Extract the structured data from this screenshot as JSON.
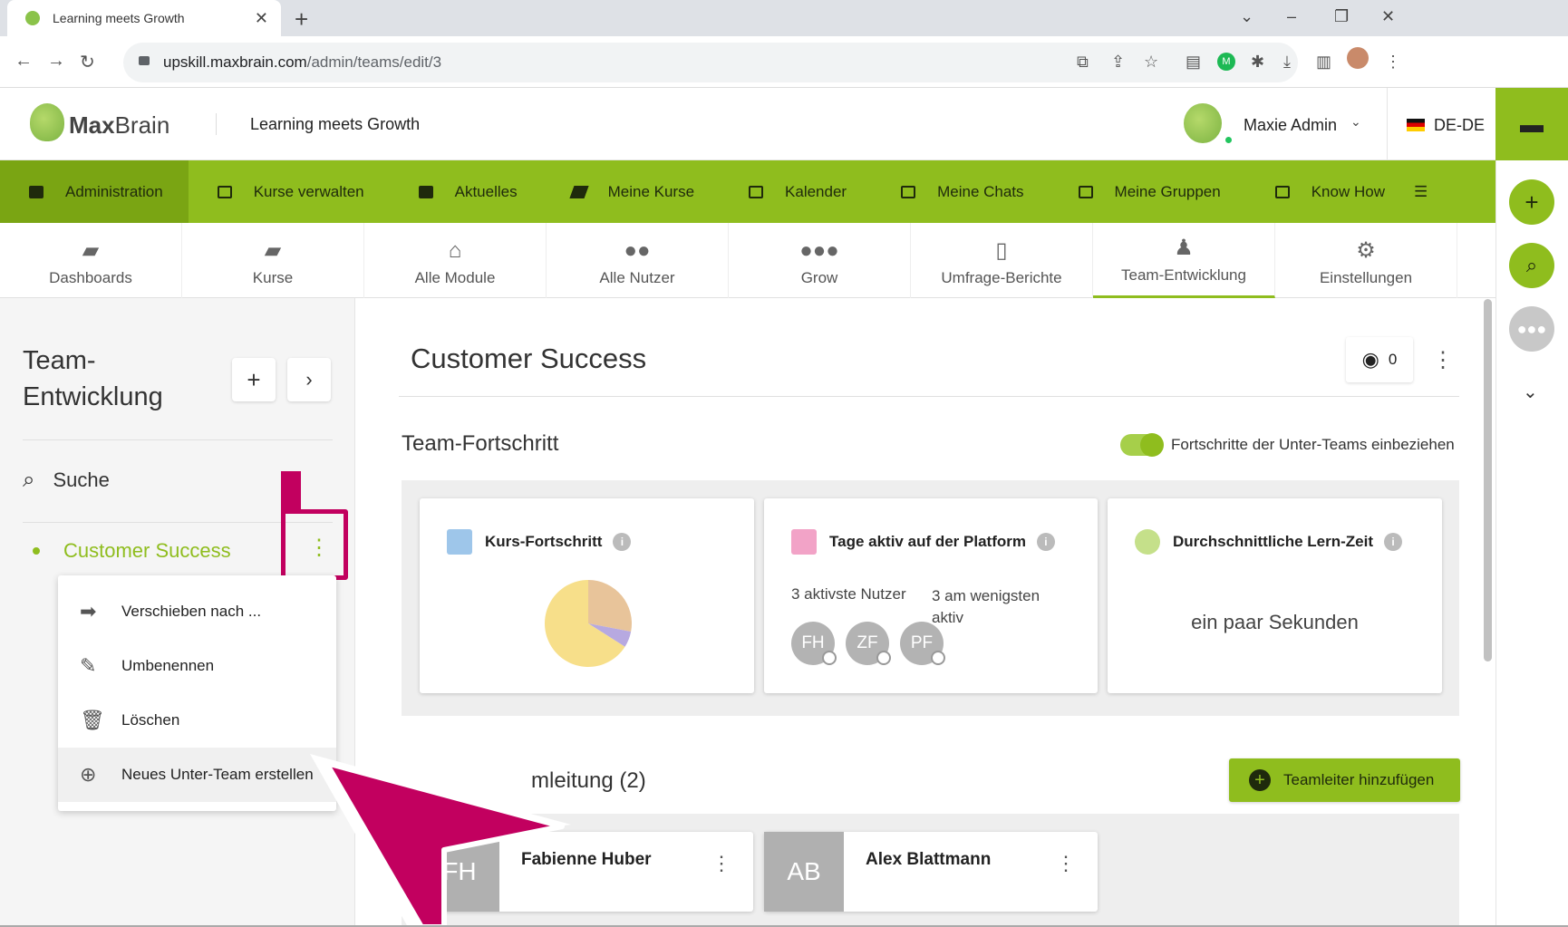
{
  "browser": {
    "tab_title": "Learning meets Growth",
    "url_host": "upskill.maxbrain.com",
    "url_path": "/admin/teams/edit/3"
  },
  "header": {
    "logo_bold": "Max",
    "logo_light": "Brain",
    "tagline": "Learning meets Growth",
    "user_name": "Maxie Admin",
    "language": "DE-DE"
  },
  "main_nav": [
    {
      "label": "Administration"
    },
    {
      "label": "Kurse verwalten"
    },
    {
      "label": "Aktuelles"
    },
    {
      "label": "Meine Kurse"
    },
    {
      "label": "Kalender"
    },
    {
      "label": "Meine Chats"
    },
    {
      "label": "Meine Gruppen"
    },
    {
      "label": "Know How"
    }
  ],
  "sub_nav": [
    {
      "label": "Dashboards"
    },
    {
      "label": "Kurse"
    },
    {
      "label": "Alle Module"
    },
    {
      "label": "Alle Nutzer"
    },
    {
      "label": "Grow"
    },
    {
      "label": "Umfrage-Berichte"
    },
    {
      "label": "Team-Entwicklung"
    },
    {
      "label": "Einstellungen"
    }
  ],
  "sidebar": {
    "title_line1": "Team-",
    "title_line2": "Entwicklung",
    "search_label": "Suche",
    "team_name": "Customer Success",
    "context_menu": [
      {
        "label": "Verschieben nach ..."
      },
      {
        "label": "Umbenennen"
      },
      {
        "label": "Löschen"
      },
      {
        "label": "Neues Unter-Team erstellen"
      }
    ]
  },
  "content": {
    "title": "Customer Success",
    "view_count": "0",
    "progress_section": "Team-Fortschritt",
    "toggle_label": "Fortschritte der Unter-Teams einbeziehen",
    "toggle_on": true,
    "cards": {
      "course_progress": "Kurs-Fortschritt",
      "days_active": "Tage aktiv auf der Platform",
      "most_active": "3 aktivste Nutzer",
      "least_active_1": "3 am wenigsten",
      "least_active_2": "aktiv",
      "avg_time": "Durchschnittliche Lern-Zeit",
      "avg_time_value": "ein paar Sekunden"
    },
    "active_users": [
      "FH",
      "ZF",
      "PF"
    ],
    "leaders_section_visible": "mleitung (2)",
    "add_leader_label": "Teamleiter hinzufügen",
    "leaders": [
      {
        "initials": "FH",
        "name": "Fabienne Huber"
      },
      {
        "initials": "AB",
        "name": "Alex Blattmann"
      }
    ]
  },
  "chart_data": {
    "type": "pie",
    "slices": [
      {
        "label": "",
        "value": 28,
        "color": "#e8c49a"
      },
      {
        "label": "",
        "value": 6,
        "color": "#b7a9e0"
      },
      {
        "label": "",
        "value": 66,
        "color": "#f7df8a"
      }
    ]
  },
  "colors": {
    "brand": "#8fbd1e",
    "annotation": "#c2005f"
  }
}
